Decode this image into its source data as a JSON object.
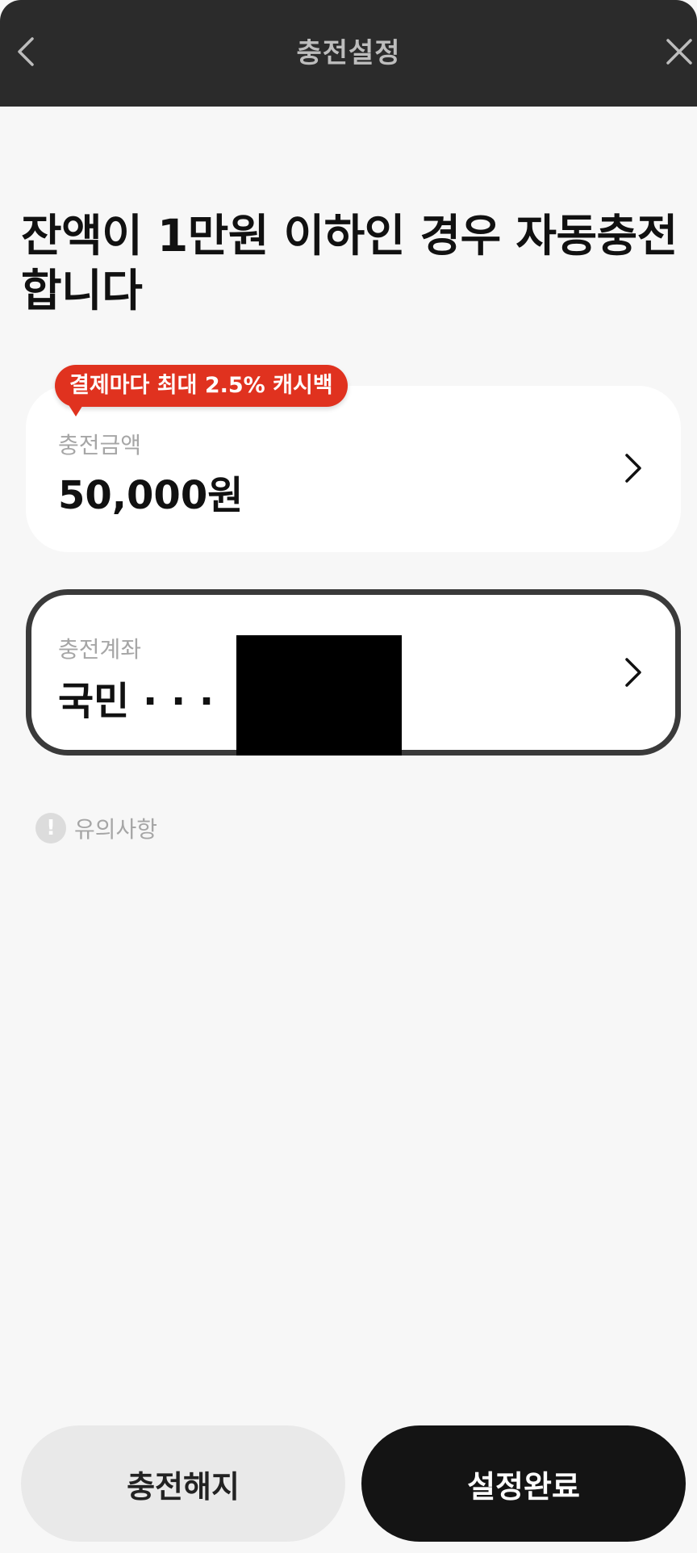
{
  "header": {
    "title": "충전설정",
    "back_icon": "chevron-left-icon",
    "close_icon": "close-icon"
  },
  "headline": "잔액이 1만원 이하인 경우 자동충전 합니다",
  "badge": {
    "text": "결제마다 최대 2.5% 캐시백",
    "color": "#e0321f"
  },
  "amount_card": {
    "label": "충전금액",
    "value": "50,000원"
  },
  "account_card": {
    "label": "충전계좌",
    "value": "국민 · · ·"
  },
  "notice": {
    "icon": "exclamation-icon",
    "text": "유의사항"
  },
  "buttons": {
    "cancel": "충전해지",
    "done": "설정완료"
  }
}
